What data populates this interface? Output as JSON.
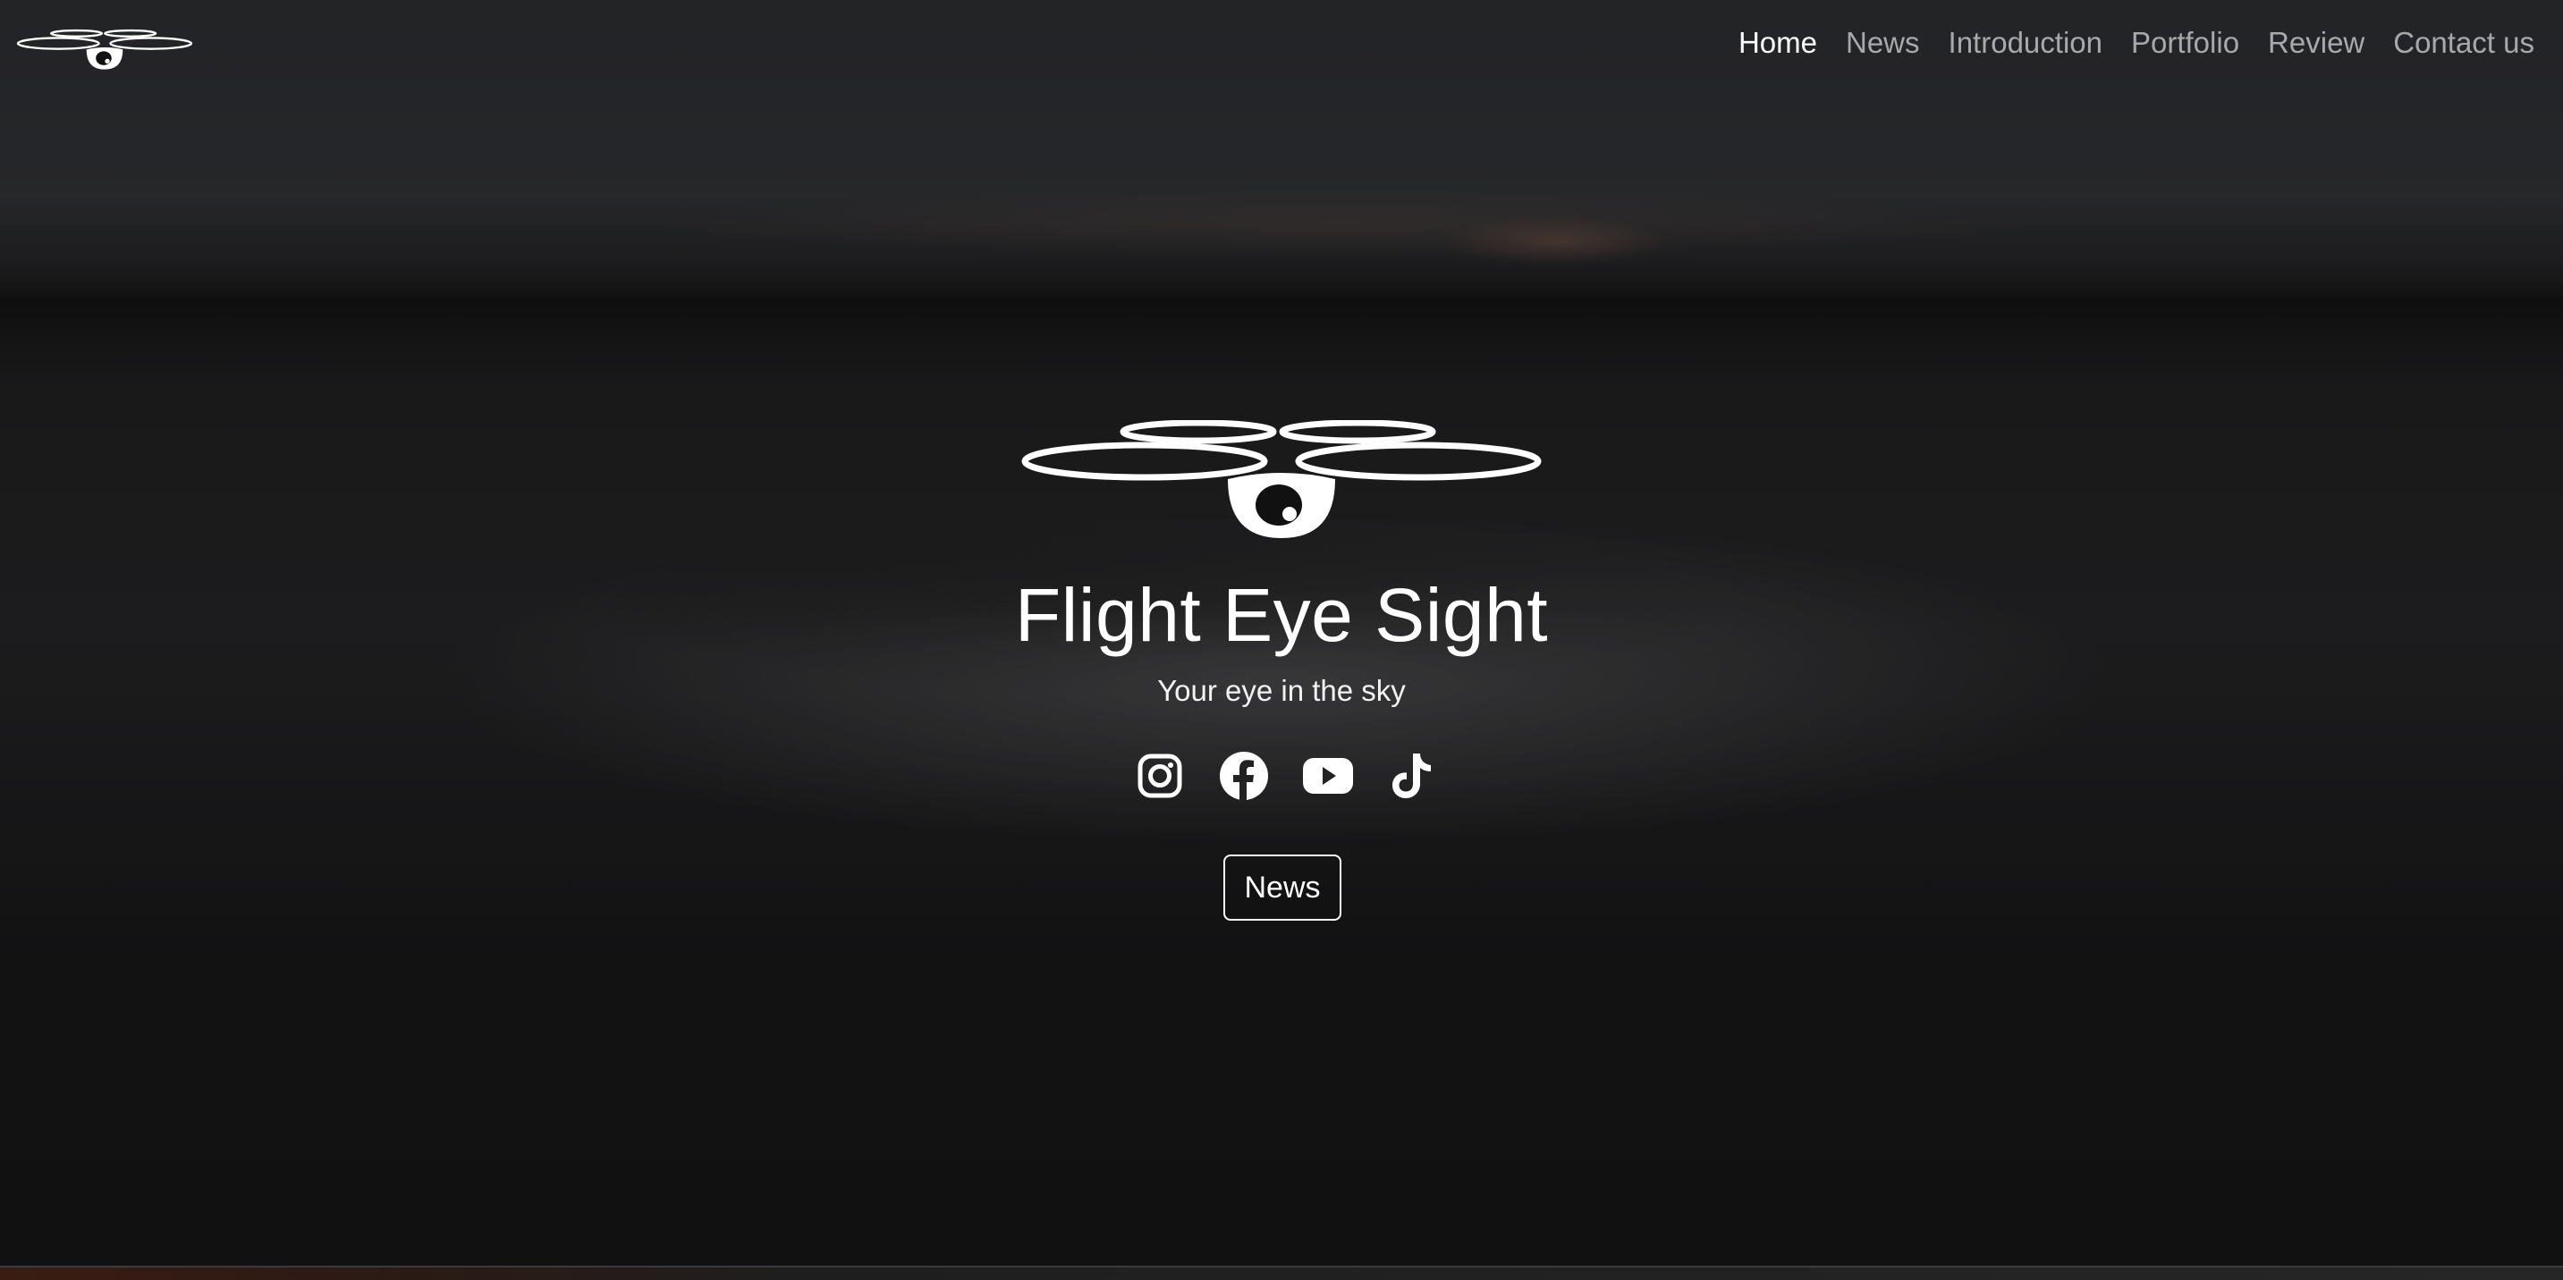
{
  "brand": {
    "logo_icon": "drone-eye-logo-icon"
  },
  "nav": {
    "items": [
      {
        "label": "Home",
        "active": true
      },
      {
        "label": "News",
        "active": false
      },
      {
        "label": "Introduction",
        "active": false
      },
      {
        "label": "Portfolio",
        "active": false
      },
      {
        "label": "Review",
        "active": false
      },
      {
        "label": "Contact us",
        "active": false
      }
    ],
    "active_color": "#ffffff",
    "inactive_color": "#a8a9ab"
  },
  "hero": {
    "logo_icon": "drone-eye-logo-icon",
    "title": "Flight Eye Sight",
    "subtitle": "Your eye in the sky",
    "socials": [
      "instagram-icon",
      "facebook-icon",
      "youtube-icon",
      "tiktok-icon"
    ],
    "cta_label": "News"
  }
}
